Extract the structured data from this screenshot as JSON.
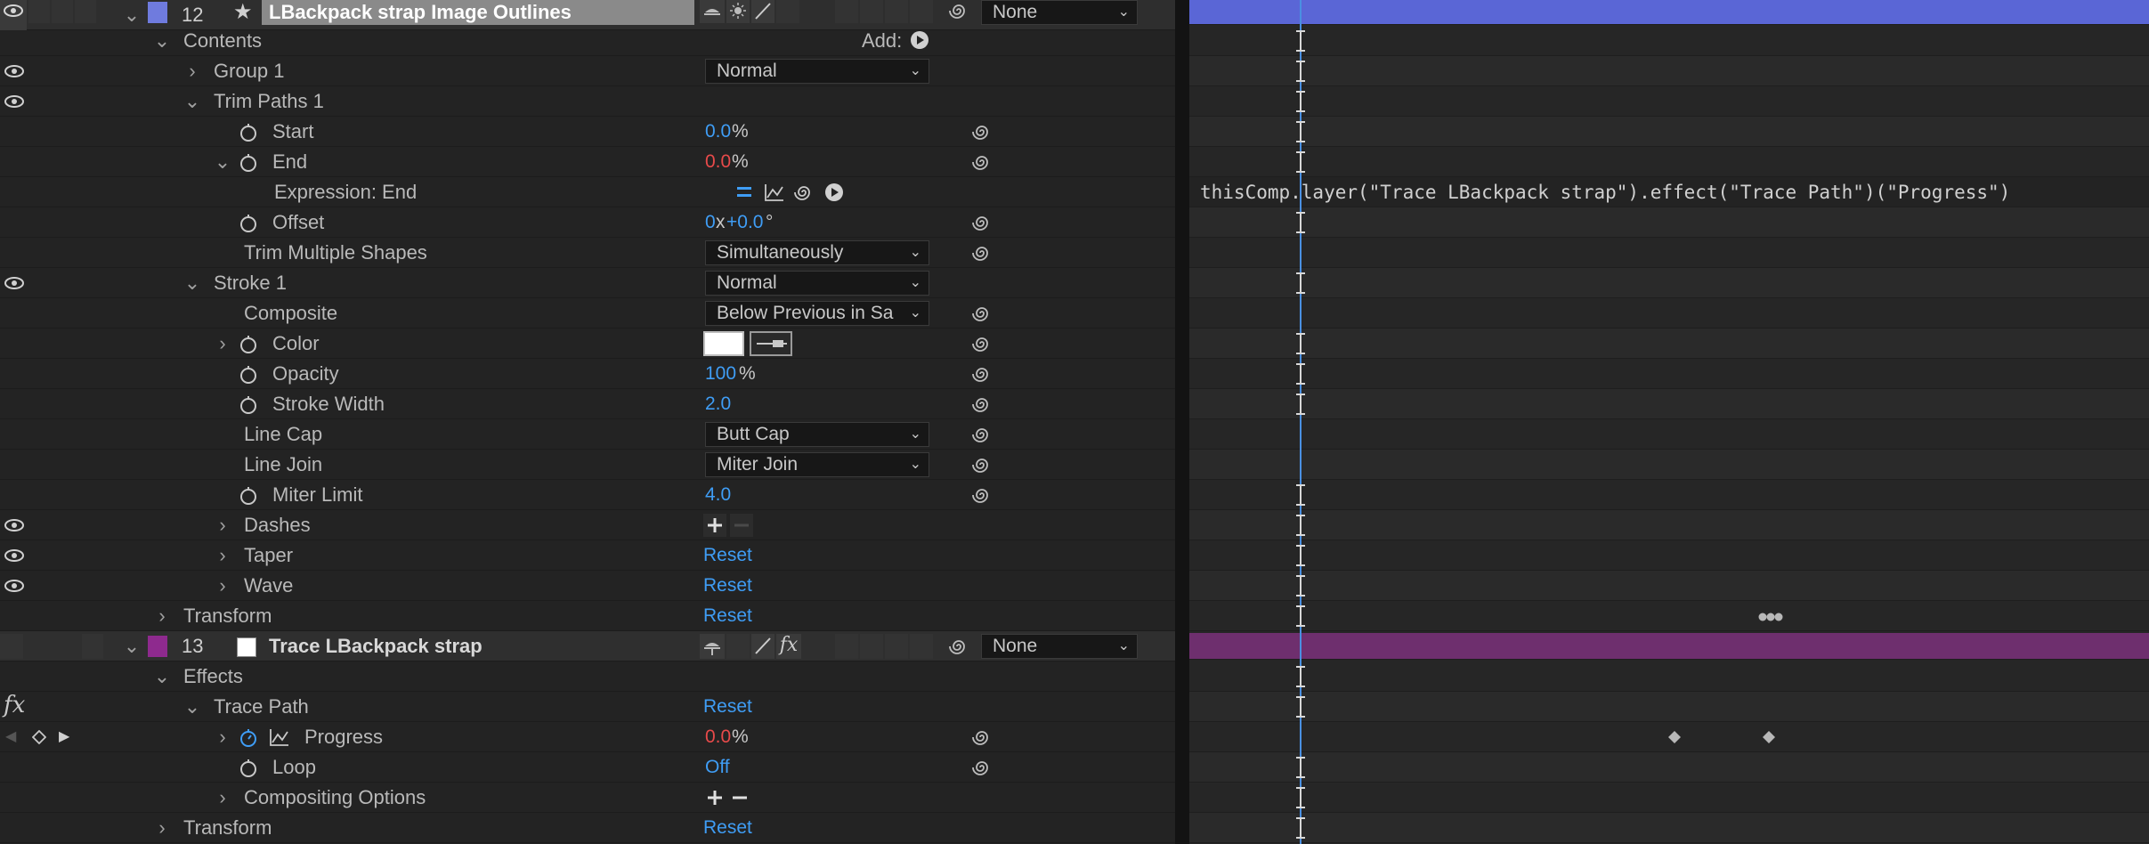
{
  "layer12": {
    "number": "12",
    "name": "LBackpack strap Image Outlines",
    "parent": "None",
    "label_color": "#6f7bde",
    "bar_color": "#5a66d6"
  },
  "layer13": {
    "number": "13",
    "name": "Trace LBackpack strap",
    "parent": "None",
    "label_color": "#8e2a8e",
    "bar_color": "#6e2f6e"
  },
  "rows": {
    "contents": "Contents",
    "add": "Add:",
    "group1": "Group 1",
    "group1_mode": "Normal",
    "trim": "Trim Paths 1",
    "start": "Start",
    "start_val": "0.0",
    "start_unit": "%",
    "end": "End",
    "end_val": "0.0",
    "end_unit": "%",
    "expr_end": "Expression: End",
    "offset": "Offset",
    "offset_rev": "0",
    "offset_x": "x",
    "offset_deg": "+0.0",
    "offset_unit": "°",
    "trim_multi": "Trim Multiple Shapes",
    "trim_multi_val": "Simultaneously",
    "stroke": "Stroke 1",
    "stroke_mode": "Normal",
    "composite": "Composite",
    "composite_val": "Below Previous in Sa",
    "color": "Color",
    "opacity": "Opacity",
    "opacity_val": "100",
    "opacity_unit": "%",
    "stroke_width": "Stroke Width",
    "stroke_width_val": "2.0",
    "line_cap": "Line Cap",
    "line_cap_val": "Butt Cap",
    "line_join": "Line Join",
    "line_join_val": "Miter Join",
    "miter": "Miter Limit",
    "miter_val": "4.0",
    "dashes": "Dashes",
    "taper": "Taper",
    "taper_val": "Reset",
    "wave": "Wave",
    "wave_val": "Reset",
    "transform1": "Transform",
    "transform1_val": "Reset",
    "effects": "Effects",
    "fx": "fx",
    "trace_path": "Trace Path",
    "trace_path_val": "Reset",
    "progress": "Progress",
    "progress_val": "0.0",
    "progress_unit": "%",
    "loop": "Loop",
    "loop_val": "Off",
    "comp_opts": "Compositing Options",
    "transform2": "Transform",
    "transform2_val": "Reset"
  },
  "expression_text": "thisComp.layer(\"Trace LBackpack strap\").effect(\"Trace Path\")(\"Progress\")",
  "colors": {
    "accent_blue": "#3f9df5",
    "keyframe_red": "#e84a4a",
    "stroke_color": "#ffffff"
  }
}
